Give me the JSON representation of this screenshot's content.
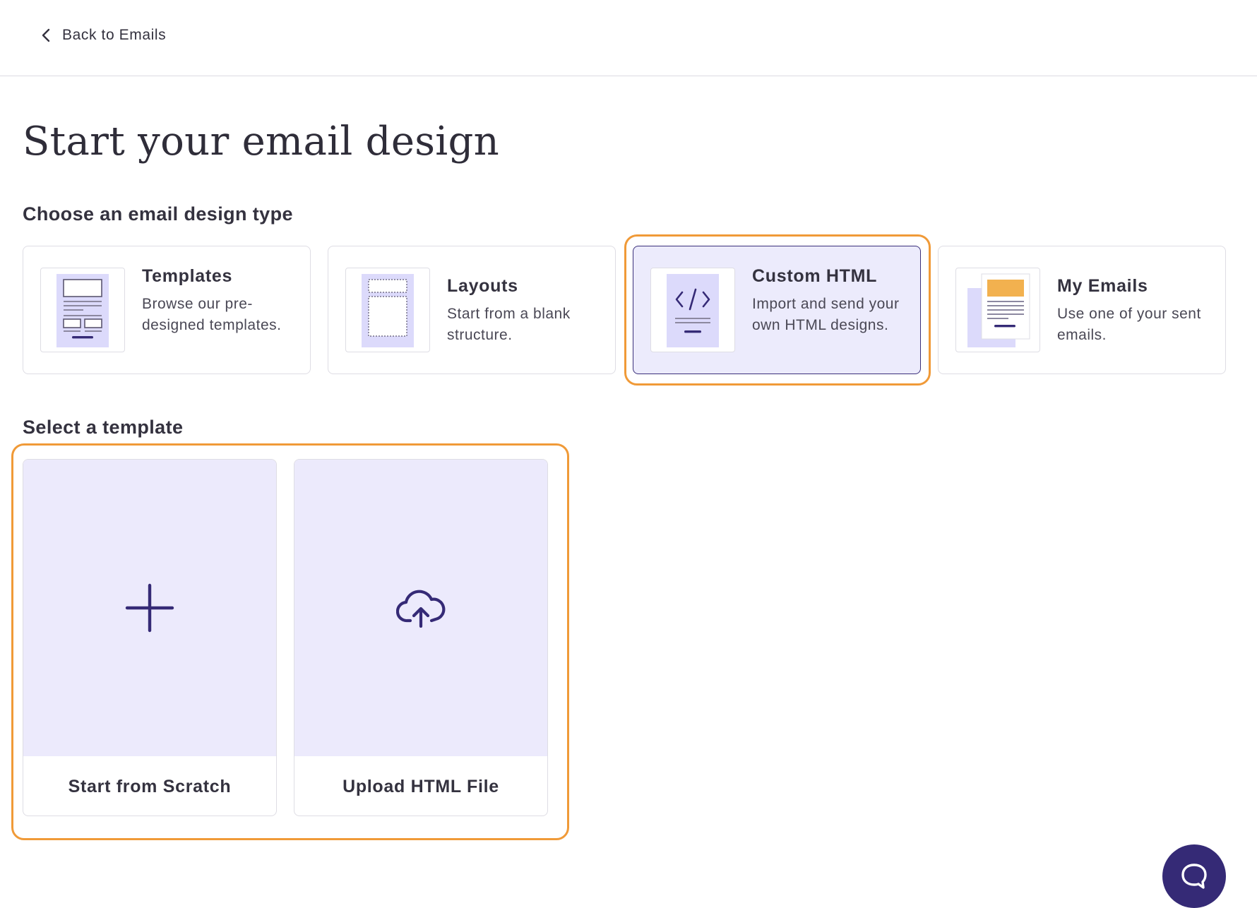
{
  "header": {
    "back_label": "Back to Emails"
  },
  "page": {
    "title": "Start your email design"
  },
  "design_types": {
    "section_label": "Choose an email design type",
    "items": [
      {
        "title": "Templates",
        "description": "Browse our pre-designed templates.",
        "icon": "templates-illustration-icon"
      },
      {
        "title": "Layouts",
        "description": "Start from a blank structure.",
        "icon": "layouts-illustration-icon"
      },
      {
        "title": "Custom HTML",
        "description": "Import and send your own HTML designs.",
        "icon": "code-illustration-icon",
        "selected": true
      },
      {
        "title": "My Emails",
        "description": "Use one of your sent emails.",
        "icon": "my-emails-illustration-icon"
      }
    ]
  },
  "templates": {
    "section_label": "Select a template",
    "items": [
      {
        "label": "Start from Scratch",
        "icon": "plus-icon"
      },
      {
        "label": "Upload HTML File",
        "icon": "cloud-upload-icon"
      }
    ]
  },
  "colors": {
    "accent": "#352a76",
    "selected_bg": "#ecebfc",
    "highlight": "#f09a38",
    "illustration_bg": "#dcdafb",
    "my_emails_accent": "#f2b14f"
  },
  "chat": {
    "icon": "chat-bubble-icon"
  }
}
